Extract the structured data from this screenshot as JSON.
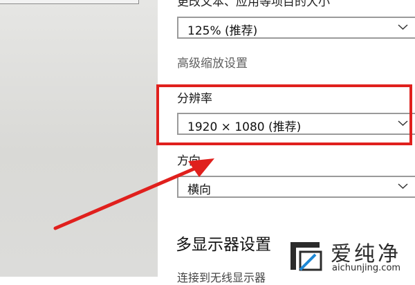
{
  "settings": {
    "scale_label_cut": "更改文本、应用等项目的大小",
    "scale_value": "125% (推荐)",
    "advanced_scaling_link": "高级缩放设置",
    "resolution_label": "分辨率",
    "resolution_value": "1920 × 1080 (推荐)",
    "orientation_label": "方向",
    "orientation_value": "横向",
    "multi_display_title": "多显示器设置",
    "wireless_display_cut": "连接到无线显示器"
  },
  "icons": [
    "chevron-down-icon",
    "red-arrow-annotation",
    "watermark-logo-icon"
  ],
  "colors": {
    "highlight": "#e0201d",
    "dropdown_border": "#9a9a9a",
    "muted_text": "#5f5f5f"
  },
  "watermark": {
    "name": "爱纯净",
    "domain": "aichunjing.com"
  }
}
